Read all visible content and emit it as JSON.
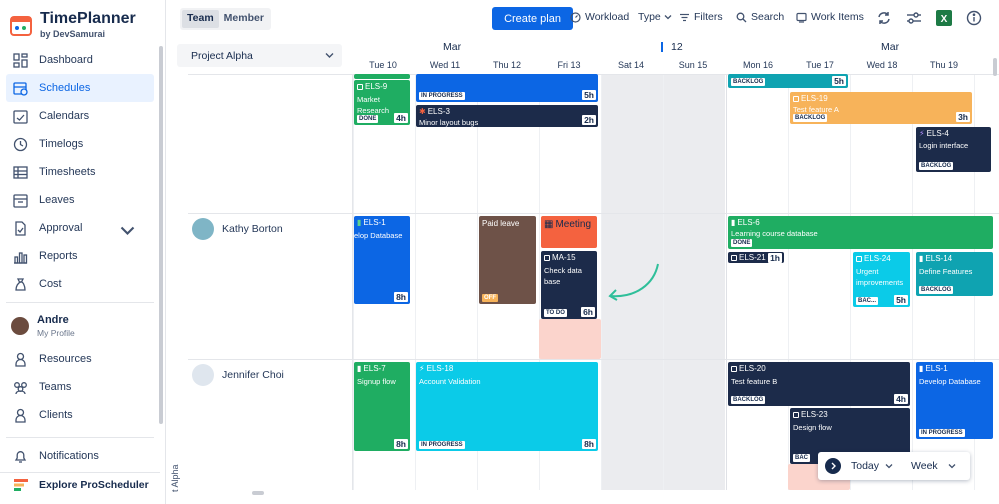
{
  "app": {
    "name": "TimePlanner",
    "by": "by DevSamurai"
  },
  "sidebar": {
    "items": [
      {
        "label": "Dashboard"
      },
      {
        "label": "Schedules"
      },
      {
        "label": "Calendars"
      },
      {
        "label": "Timelogs"
      },
      {
        "label": "Timesheets"
      },
      {
        "label": "Leaves"
      },
      {
        "label": "Approval"
      },
      {
        "label": "Reports"
      },
      {
        "label": "Cost"
      }
    ],
    "profile": {
      "name": "Andre",
      "sub": "My Profile"
    },
    "items2": [
      {
        "label": "Resources"
      },
      {
        "label": "Teams"
      },
      {
        "label": "Clients"
      }
    ],
    "notifications": "Notifications",
    "explore": "Explore ProScheduler"
  },
  "toolbar": {
    "team": "Team",
    "member": "Member",
    "create": "Create plan",
    "workload": "Workload",
    "type": "Type",
    "filters": "Filters",
    "search": "Search",
    "work_items": "Work Items"
  },
  "project": {
    "selected": "Project Alpha",
    "vertical": "t Alpha"
  },
  "calendar": {
    "month1": "Mar",
    "week_num": "12",
    "month2": "Mar",
    "days": [
      "Tue 10",
      "Wed 11",
      "Thu 12",
      "Fri 13",
      "Sat 14",
      "Sun 15",
      "Mon 16",
      "Tue 17",
      "Wed 18",
      "Thu 19"
    ]
  },
  "resources": [
    "Kathy Borton",
    "Jennifer Choi"
  ],
  "cards": {
    "els9_id": "ELS-9",
    "els9_title": "Market Research",
    "els9_badge": "DONE",
    "els9_hrs": "4h",
    "blue_hrs": "5h",
    "blue_badge": "IN PROGRESS",
    "els3_id": "ELS-3",
    "els3_title": "Minor layout bugs",
    "els3_hrs": "2h",
    "teal_badge": "BACKLOG",
    "teal_hrs": "5h",
    "els19_id": "ELS-19",
    "els19_title": "Test feature A",
    "els19_badge": "BACKLOG",
    "els19_hrs": "3h",
    "els4_id": "ELS-4",
    "els4_title": "Login interface",
    "els4_badge": "BACKLOG",
    "els1_id": "ELS-1",
    "els1_title": "elop Database",
    "els1_hrs": "8h",
    "paid_leave": "Paid leave",
    "off": "OFF",
    "meeting": "Meeting",
    "ma15_id": "MA-15",
    "ma15_title": "Check data base",
    "ma15_badge": "TO DO",
    "ma15_hrs": "6h",
    "els6_id": "ELS-6",
    "els6_title": "Learning course database",
    "els6_badge": "DONE",
    "els21_id": "ELS-21",
    "els21_hrs": "1h",
    "els24_id": "ELS-24",
    "els24_title": "Urgent improvements",
    "els24_badge": "BAC...",
    "els24_hrs": "5h",
    "els14_id": "ELS-14",
    "els14_title": "Define Features",
    "els14_badge": "BACKLOG",
    "els7_id": "ELS-7",
    "els7_title": "Signup flow",
    "els7_hrs": "8h",
    "els18_id": "ELS-18",
    "els18_title": "Account Validation",
    "els18_badge": "IN PROGRESS",
    "els18_hrs": "8h",
    "els20_id": "ELS-20",
    "els20_title": "Test feature B",
    "els20_badge": "BACKLOG",
    "els20_hrs": "4h",
    "els1b_id": "ELS-1",
    "els1b_title": "Develop Database",
    "els1b_badge": "IN PROGRESS",
    "els23_id": "ELS-23",
    "els23_title": "Design flow",
    "els23_badge": "BAC"
  },
  "footer": {
    "today": "Today",
    "week": "Week"
  },
  "colors": {
    "primary": "#0c66e4",
    "green": "#1fad62",
    "navy": "#1c2b4a",
    "cyan": "#0bcbe8",
    "orange": "#f7b35a",
    "brown": "#6e5248",
    "red": "#f4623f"
  }
}
